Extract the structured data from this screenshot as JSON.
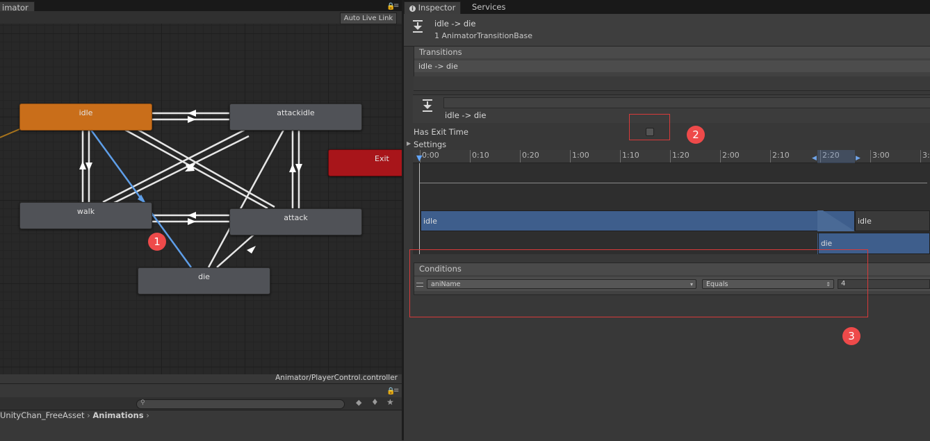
{
  "animator": {
    "tab_label": "imator",
    "live_link_button": "Auto Live Link",
    "controller_path": "Animator/PlayerControl.controller",
    "states": [
      {
        "label": "idle"
      },
      {
        "label": "attackidle"
      },
      {
        "label": "Exit"
      },
      {
        "label": "walk"
      },
      {
        "label": "attack"
      },
      {
        "label": "die"
      }
    ]
  },
  "project": {
    "breadcrumb": [
      "UnityChan_FreeAsset",
      "Animations"
    ],
    "search_placeholder": ""
  },
  "inspector": {
    "tabs": [
      {
        "label": "Inspector"
      },
      {
        "label": "Services"
      }
    ],
    "header": {
      "title": "idle -> die",
      "subtitle": "1 AnimatorTransitionBase"
    },
    "transitions": {
      "title": "Transitions",
      "items": [
        "idle -> die"
      ]
    },
    "transition_name": "idle -> die",
    "has_exit_time": {
      "label": "Has Exit Time",
      "checked": false
    },
    "settings_label": "Settings",
    "timeline": {
      "ticks": [
        "0:00",
        "0:10",
        "0:20",
        "1:00",
        "1:10",
        "1:20",
        "2:00",
        "2:10",
        "2:20",
        "3:00",
        "3:"
      ],
      "source_clip": "idle",
      "source_clip_repeat": "idle",
      "dest_clip": "die"
    },
    "conditions": {
      "title": "Conditions",
      "rows": [
        {
          "parameter": "aniName",
          "mode": "Equals",
          "value": "4"
        }
      ]
    }
  },
  "annotations": {
    "marker1": "1",
    "marker2": "2",
    "marker3": "3"
  },
  "colors": {
    "accent_orange": "#c96e1a",
    "exit_red": "#a8151a",
    "transition_blue": "#5e9ee8",
    "annotation_red": "#ee4a4a"
  }
}
